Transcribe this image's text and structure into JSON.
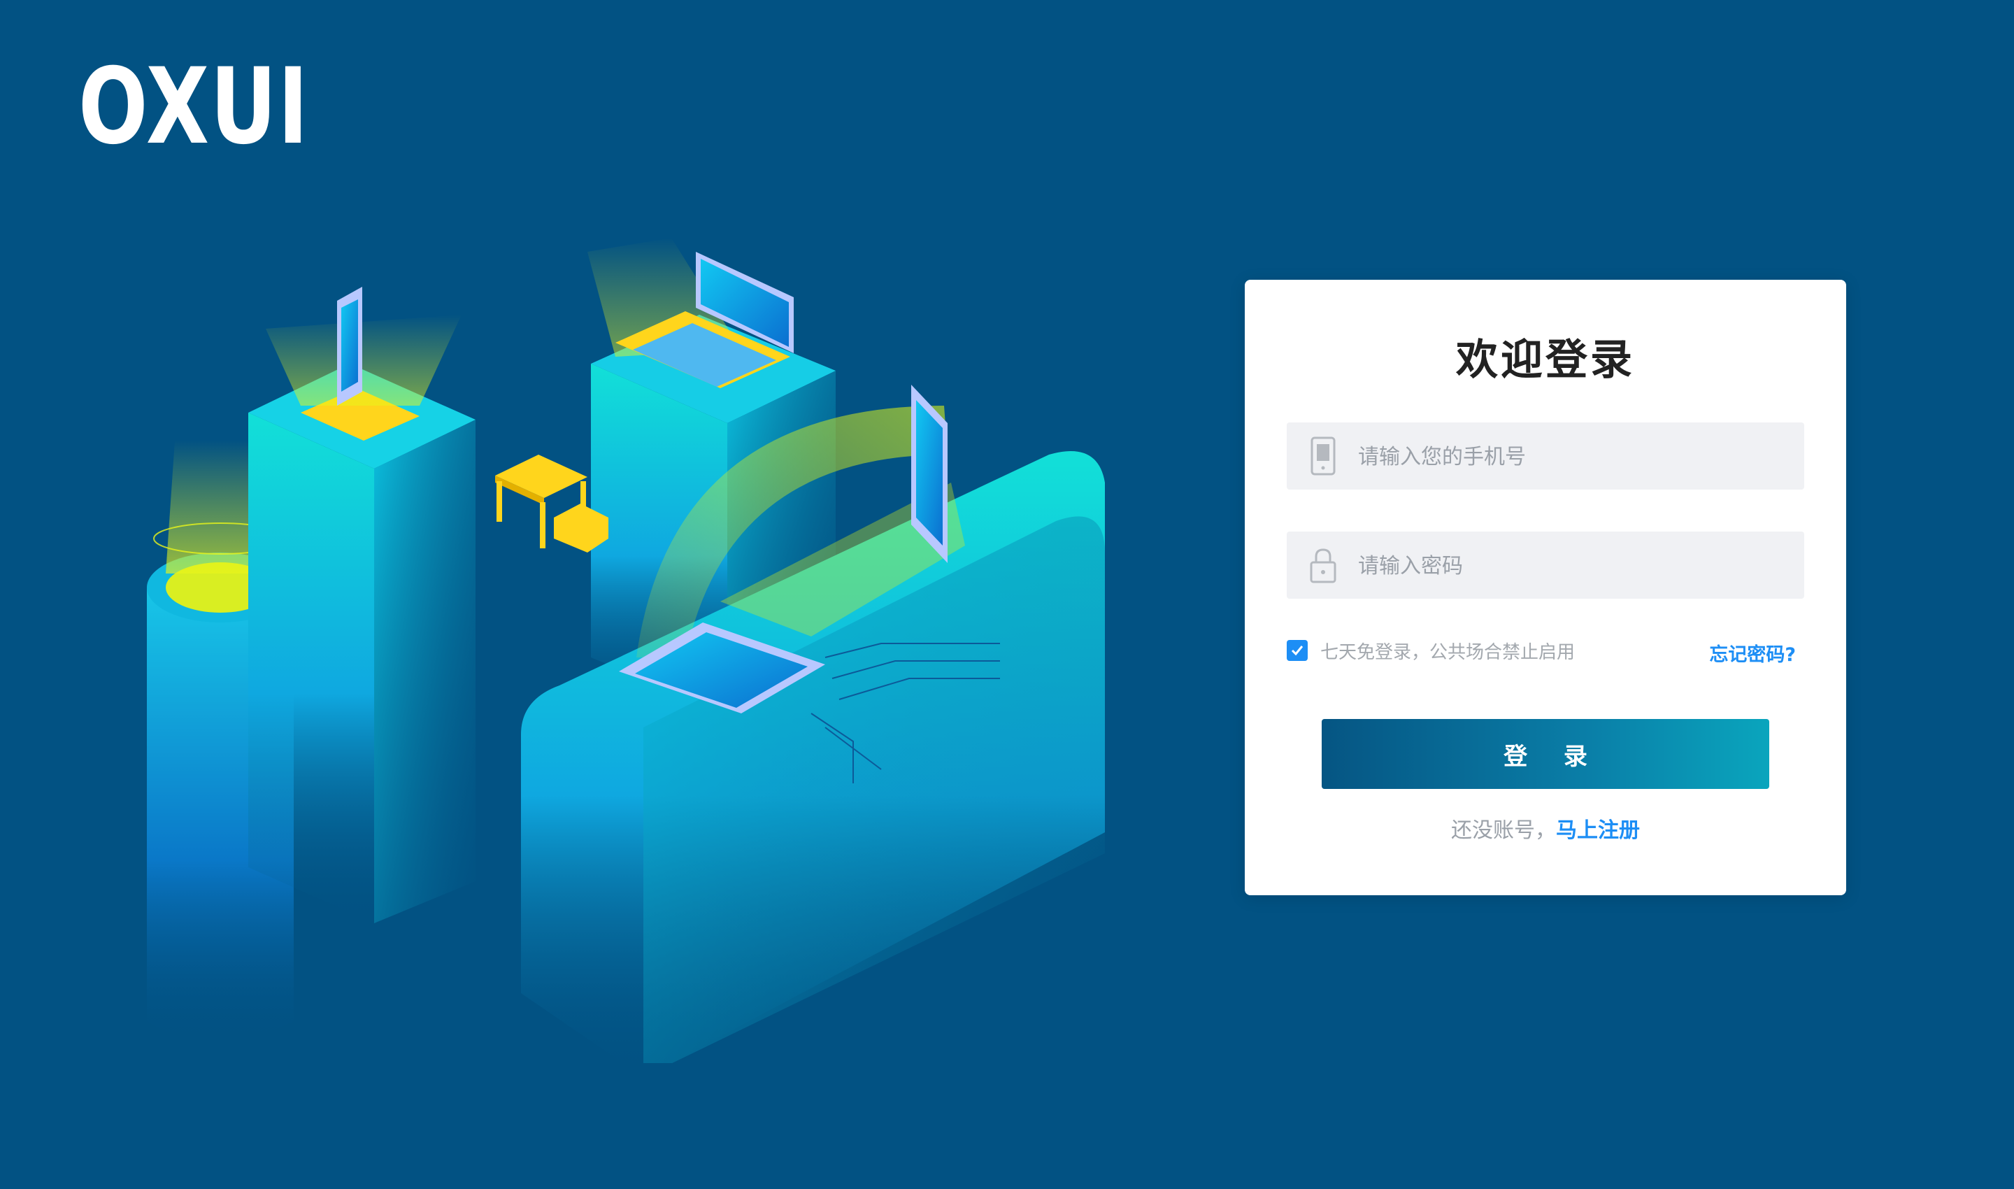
{
  "brand": {
    "logo_text": "OXUI"
  },
  "login": {
    "title": "欢迎登录",
    "phone": {
      "placeholder": "请输入您的手机号",
      "value": "",
      "icon": "phone-icon"
    },
    "password": {
      "placeholder": "请输入密码",
      "value": "",
      "icon": "lock-icon"
    },
    "remember": {
      "checked": true,
      "label": "七天免登录，公共场合禁止启用"
    },
    "forgot_label": "忘记密码?",
    "submit_label": "登 录",
    "no_account_text": "还没账号，",
    "register_label": "马上注册"
  },
  "colors": {
    "background": "#025283",
    "accent": "#1d8ef5",
    "button_gradient_start": "#055583",
    "button_gradient_end": "#0aa5bd"
  }
}
